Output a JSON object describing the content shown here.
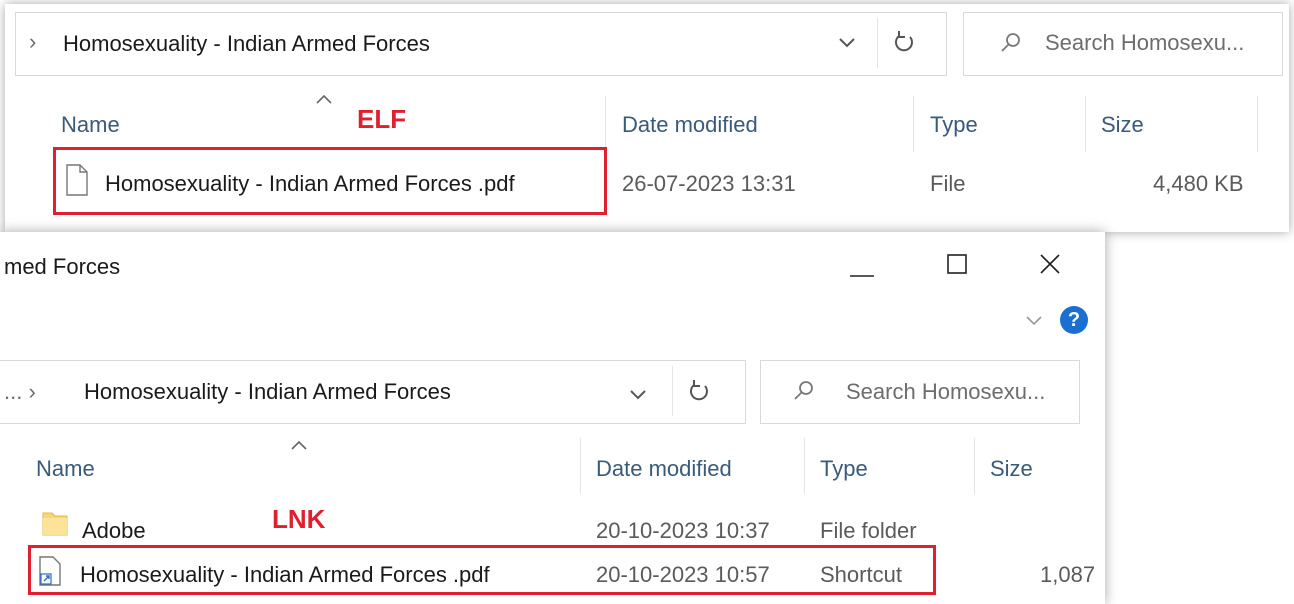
{
  "back_window": {
    "breadcrumb_chevron": "›",
    "address_path": "Homosexuality - Indian Armed Forces",
    "search_placeholder": "Search Homosexu...",
    "columns": {
      "name": "Name",
      "date_modified": "Date modified",
      "type": "Type",
      "size": "Size"
    },
    "annotation": "ELF",
    "rows": [
      {
        "name": "Homosexuality - Indian Armed Forces .pdf",
        "date_modified": "26-07-2023 13:31",
        "type": "File",
        "size": "4,480 KB",
        "icon": "file-icon"
      }
    ]
  },
  "front_window": {
    "title_partial": "med Forces",
    "help_label": "?",
    "breadcrumb_prefix": "... ›",
    "address_path": "Homosexuality - Indian Armed Forces",
    "search_placeholder": "Search Homosexu...",
    "columns": {
      "name": "Name",
      "date_modified": "Date modified",
      "type": "Type",
      "size": "Size"
    },
    "annotation": "LNK",
    "rows": [
      {
        "name": "Adobe",
        "date_modified": "20-10-2023 10:37",
        "type": "File folder",
        "size": "",
        "icon": "folder-icon"
      },
      {
        "name": "Homosexuality - Indian Armed Forces .pdf",
        "date_modified": "20-10-2023 10:57",
        "type": "Shortcut",
        "size": "1,087",
        "icon": "shortcut-icon"
      }
    ]
  },
  "colors": {
    "annotation_red": "#e0202e",
    "help_blue": "#1a6fd0",
    "header_text": "#3a5a7a"
  }
}
